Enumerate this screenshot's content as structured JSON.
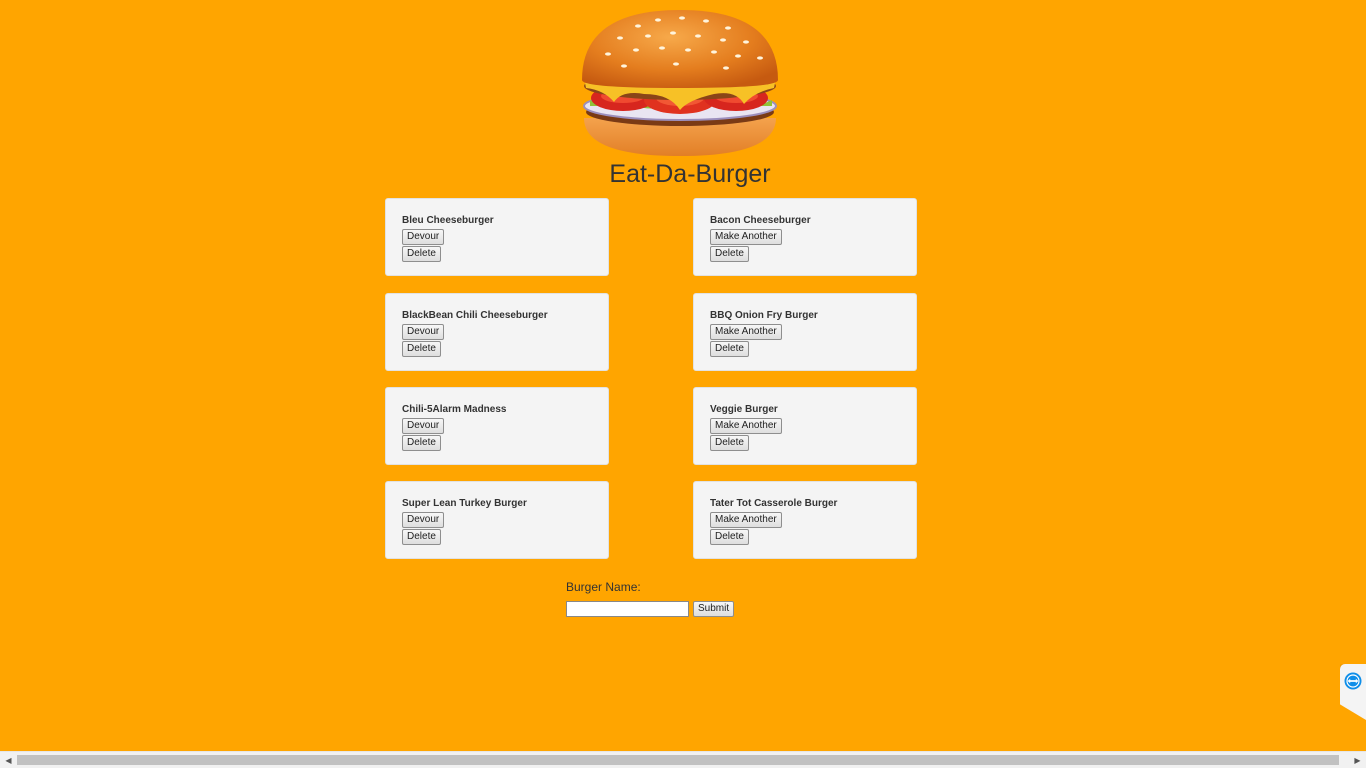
{
  "header": {
    "title": "Eat-Da-Burger"
  },
  "burgers": {
    "uneaten": [
      {
        "name": "Bleu Cheeseburger",
        "action_label": "Devour",
        "delete_label": "Delete"
      },
      {
        "name": "BlackBean Chili Cheeseburger",
        "action_label": "Devour",
        "delete_label": "Delete"
      },
      {
        "name": "Chili-5Alarm Madness",
        "action_label": "Devour",
        "delete_label": "Delete"
      },
      {
        "name": "Super Lean Turkey Burger",
        "action_label": "Devour",
        "delete_label": "Delete"
      }
    ],
    "devoured": [
      {
        "name": "Bacon Cheeseburger",
        "action_label": "Make Another",
        "delete_label": "Delete"
      },
      {
        "name": "BBQ Onion Fry Burger",
        "action_label": "Make Another",
        "delete_label": "Delete"
      },
      {
        "name": "Veggie Burger",
        "action_label": "Make Another",
        "delete_label": "Delete"
      },
      {
        "name": "Tater Tot Casserole Burger",
        "action_label": "Make Another",
        "delete_label": "Delete"
      }
    ]
  },
  "form": {
    "label": "Burger Name:",
    "input_value": "",
    "submit_label": "Submit"
  },
  "icons": {
    "logo": "burger-icon",
    "widget": "teamviewer-icon"
  },
  "colors": {
    "background": "#ffa500",
    "card": "#f4f4f4"
  }
}
